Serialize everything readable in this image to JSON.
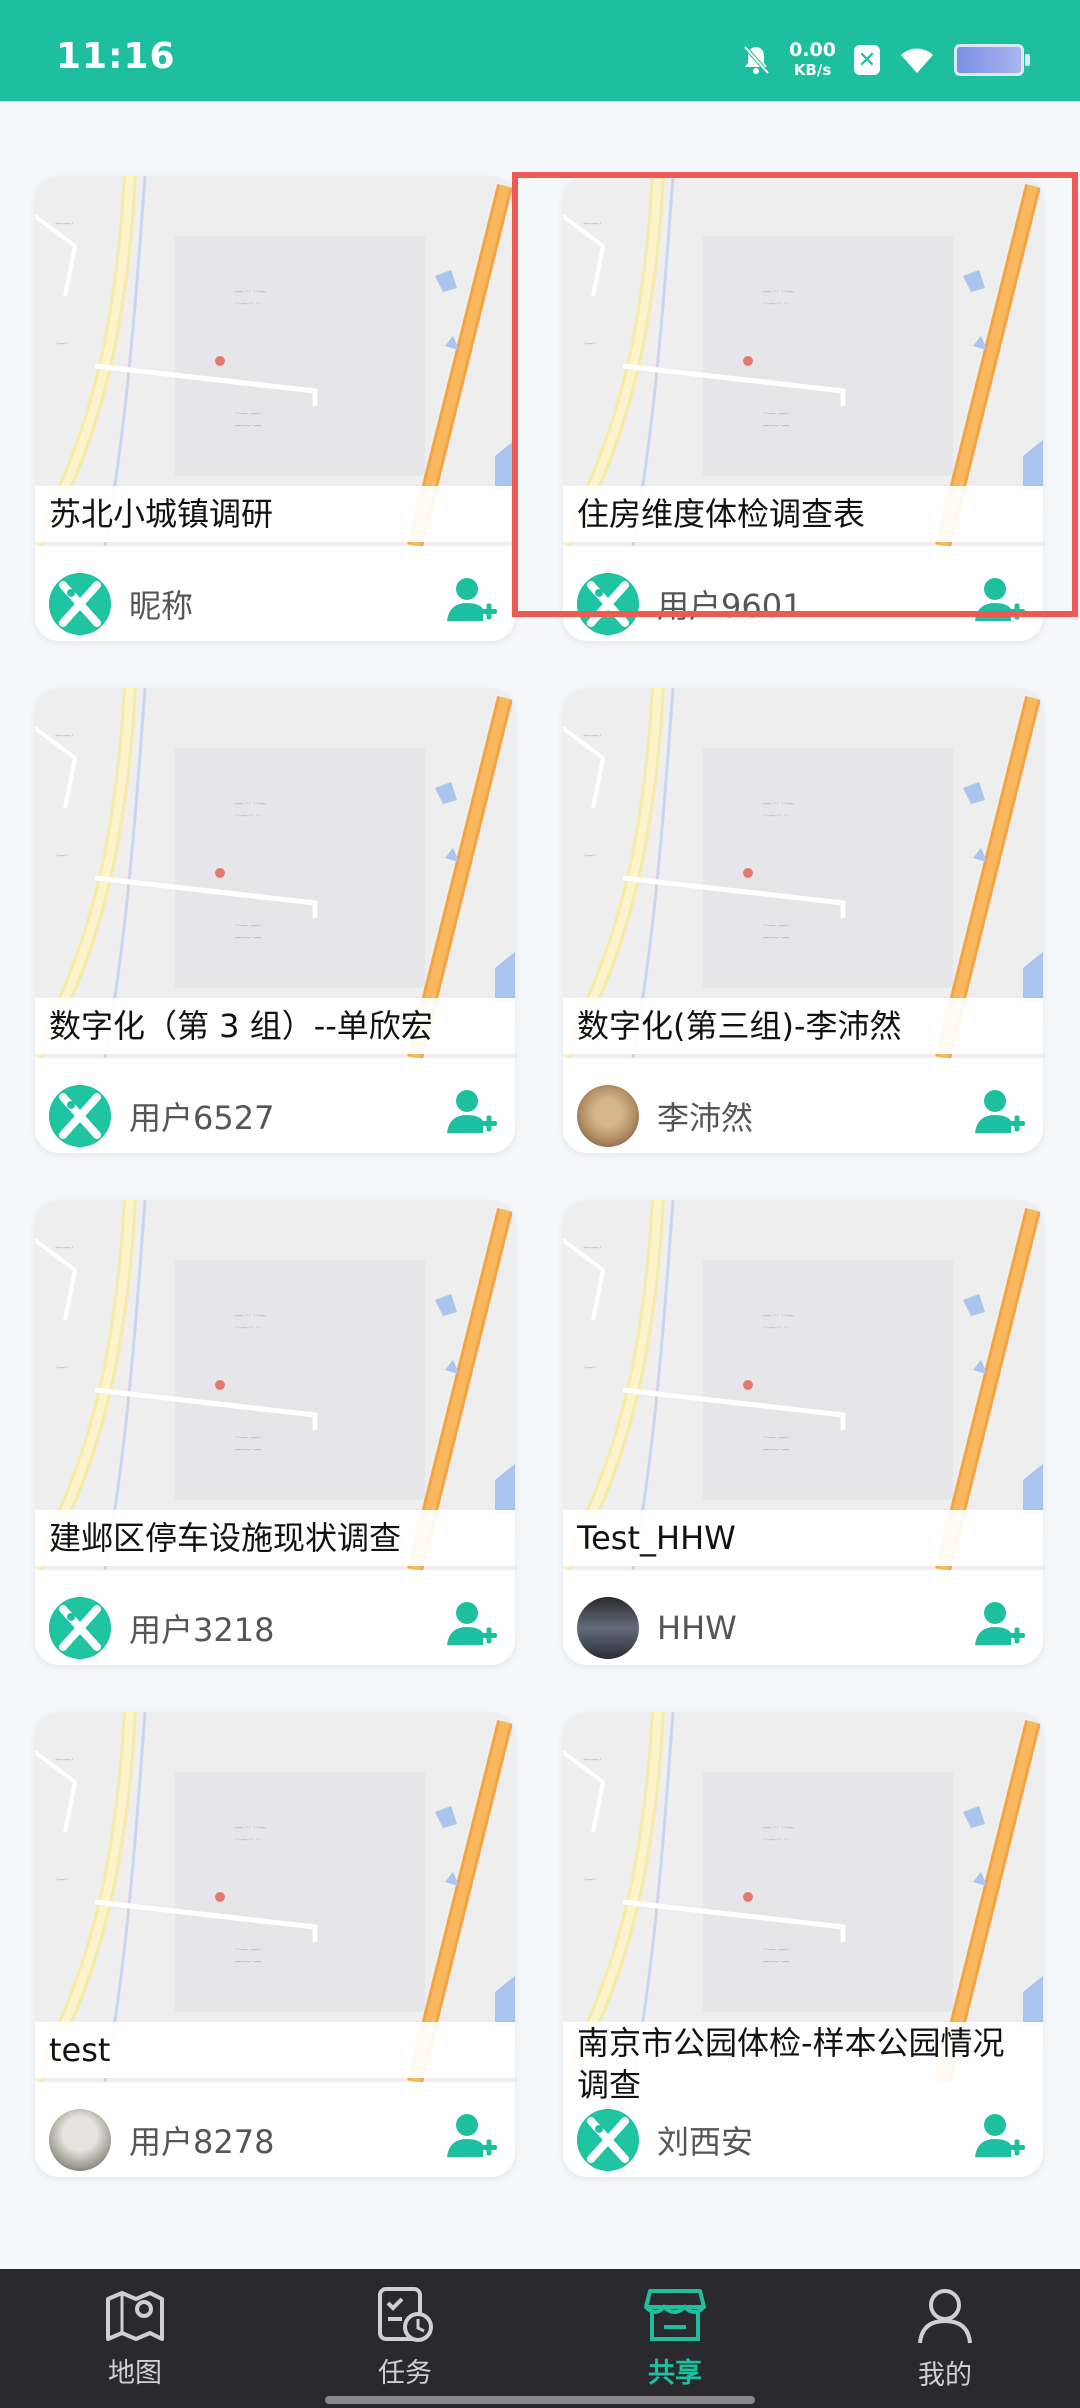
{
  "status_bar": {
    "time": "11:16",
    "net_speed_value": "0.00",
    "net_speed_unit": "KB/s"
  },
  "cards": [
    {
      "title": "苏北小城镇调研",
      "user": "昵称",
      "avatar": "logo"
    },
    {
      "title": "住房维度体检调查表",
      "user": "用户9601",
      "avatar": "logo"
    },
    {
      "title": "数字化（第 3 组）--单欣宏",
      "user": "用户6527",
      "avatar": "logo"
    },
    {
      "title": "数字化(第三组)-李沛然",
      "user": "李沛然",
      "avatar": "photo-cat"
    },
    {
      "title": "建邺区停车设施现状调查",
      "user": "用户3218",
      "avatar": "logo"
    },
    {
      "title": "Test_HHW",
      "user": "HHW",
      "avatar": "photo-dark"
    },
    {
      "title": "test",
      "user": "用户8278",
      "avatar": "photo-gray"
    },
    {
      "title": "南京市公园体检-样本公园情况调查",
      "user": "刘西安",
      "avatar": "logo"
    }
  ],
  "bottom_nav": [
    {
      "label": "地图",
      "icon": "map-icon",
      "active": false
    },
    {
      "label": "任务",
      "icon": "task-clock-icon",
      "active": false
    },
    {
      "label": "共享",
      "icon": "store-icon",
      "active": true
    },
    {
      "label": "我的",
      "icon": "person-icon",
      "active": false
    }
  ],
  "colors": {
    "accent": "#1dbf9f",
    "highlight": "#ec5a53",
    "nav_bg": "#2a2a2e"
  }
}
